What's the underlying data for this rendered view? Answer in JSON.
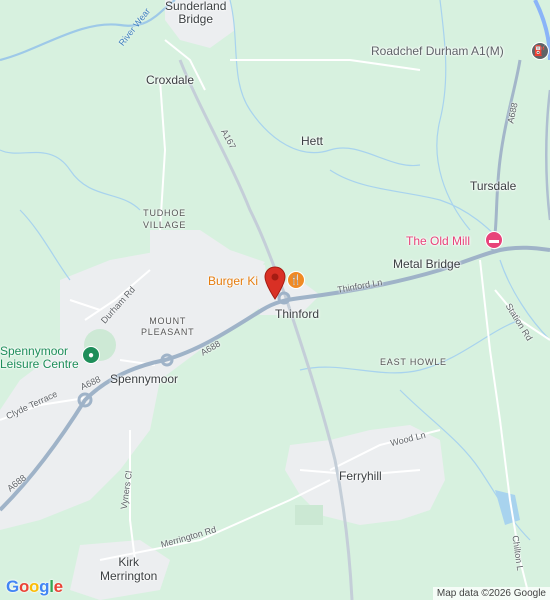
{
  "map": {
    "places": {
      "sunderland_bridge": "Sunderland\nBridge",
      "croxdale": "Croxdale",
      "hett": "Hett",
      "tursdale": "Tursdale",
      "tudhoe_village": "TUDHOE\nVILLAGE",
      "metal_bridge": "Metal Bridge",
      "thinford": "Thinford",
      "mount_pleasant": "MOUNT\nPLEASANT",
      "spennymoor": "Spennymoor",
      "east_howle": "EAST HOWLE",
      "ferryhill": "Ferryhill",
      "kirk_merrington": "Kirk\nMerrington"
    },
    "roads": {
      "a167": "A167",
      "a688_northeast": "A688",
      "a688_spennymoor": "A688",
      "a688_west": "A688",
      "a688_southwest": "A688",
      "thinford_ln": "Thinford Ln",
      "durham_rd": "Durham Rd",
      "clyde_terrace": "Clyde Terrace",
      "vyners_cl": "Vyners Cl",
      "merrington_rd": "Merrington Rd",
      "wood_ln": "Wood Ln",
      "station_rd": "Station Rd",
      "chilton_l": "Chilton L"
    },
    "water": {
      "river_wear": "River Wear"
    },
    "pois": {
      "roadchef": {
        "label": "Roadchef Durham A1(M)",
        "icon": "gas-station-icon",
        "color": "#5f6368"
      },
      "old_mill": {
        "label": "The Old Mill",
        "icon": "hotel-icon",
        "color": "#e8437a"
      },
      "burger_king": {
        "label": "Burger Ki",
        "icon": "restaurant-icon",
        "color": "#f08a24"
      },
      "leisure_centre": {
        "label": "Spennymoor\nLeisure Centre",
        "icon": "leisure-icon",
        "color": "#1e8e5a"
      }
    },
    "marker": {
      "icon": "location-pin-icon",
      "color": "#d93025"
    },
    "logo": "Google",
    "attribution": "Map data ©2026 Google"
  }
}
